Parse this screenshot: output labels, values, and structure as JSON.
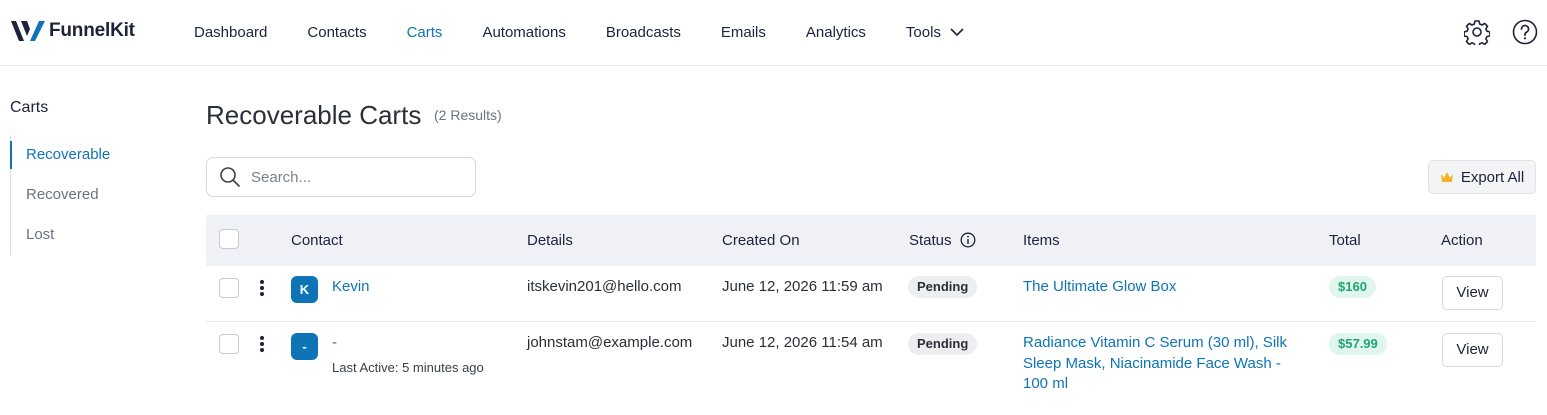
{
  "brand": {
    "name": "FunnelKit",
    "logo_color": "#1d2339"
  },
  "nav": {
    "items": [
      {
        "label": "Dashboard",
        "active": false
      },
      {
        "label": "Contacts",
        "active": false
      },
      {
        "label": "Carts",
        "active": true
      },
      {
        "label": "Automations",
        "active": false
      },
      {
        "label": "Broadcasts",
        "active": false
      },
      {
        "label": "Emails",
        "active": false
      },
      {
        "label": "Analytics",
        "active": false
      },
      {
        "label": "Tools",
        "active": false,
        "icon": "chevron-down-icon"
      }
    ],
    "right_icons": [
      "gear-icon",
      "help-icon"
    ]
  },
  "sidebar": {
    "title": "Carts",
    "items": [
      {
        "label": "Recoverable",
        "active": true
      },
      {
        "label": "Recovered",
        "active": false
      },
      {
        "label": "Lost",
        "active": false
      }
    ]
  },
  "page": {
    "title": "Recoverable Carts",
    "result_count": "(2 Results)",
    "search_placeholder": "Search...",
    "export_label": "Export All",
    "export_icon": "crown-icon"
  },
  "table": {
    "columns": [
      "Contact",
      "Details",
      "Created On",
      "Status",
      "Items",
      "Total",
      "Action"
    ],
    "status_info_icon": "info-icon",
    "rows": [
      {
        "avatar": "K",
        "contact": "Kevin",
        "last_active": "",
        "details": "itskevin201@hello.com",
        "created_on": "June 12, 2026 11:59 am",
        "status": "Pending",
        "items": "The Ultimate Glow Box",
        "total": "$160",
        "action": "View"
      },
      {
        "avatar": "-",
        "contact": "-",
        "last_active": "Last Active: 5 minutes ago",
        "details": "johnstam@example.com",
        "created_on": "June 12, 2026 11:54 am",
        "status": "Pending",
        "items": "Radiance Vitamin C Serum (30 ml), Silk Sleep Mask, Niacinamide Face Wash - 100 ml",
        "total": "$57.99",
        "action": "View"
      }
    ]
  },
  "colors": {
    "accent": "#0e74b5",
    "success": "#1ea672",
    "header_bg": "#f0f1f7"
  }
}
